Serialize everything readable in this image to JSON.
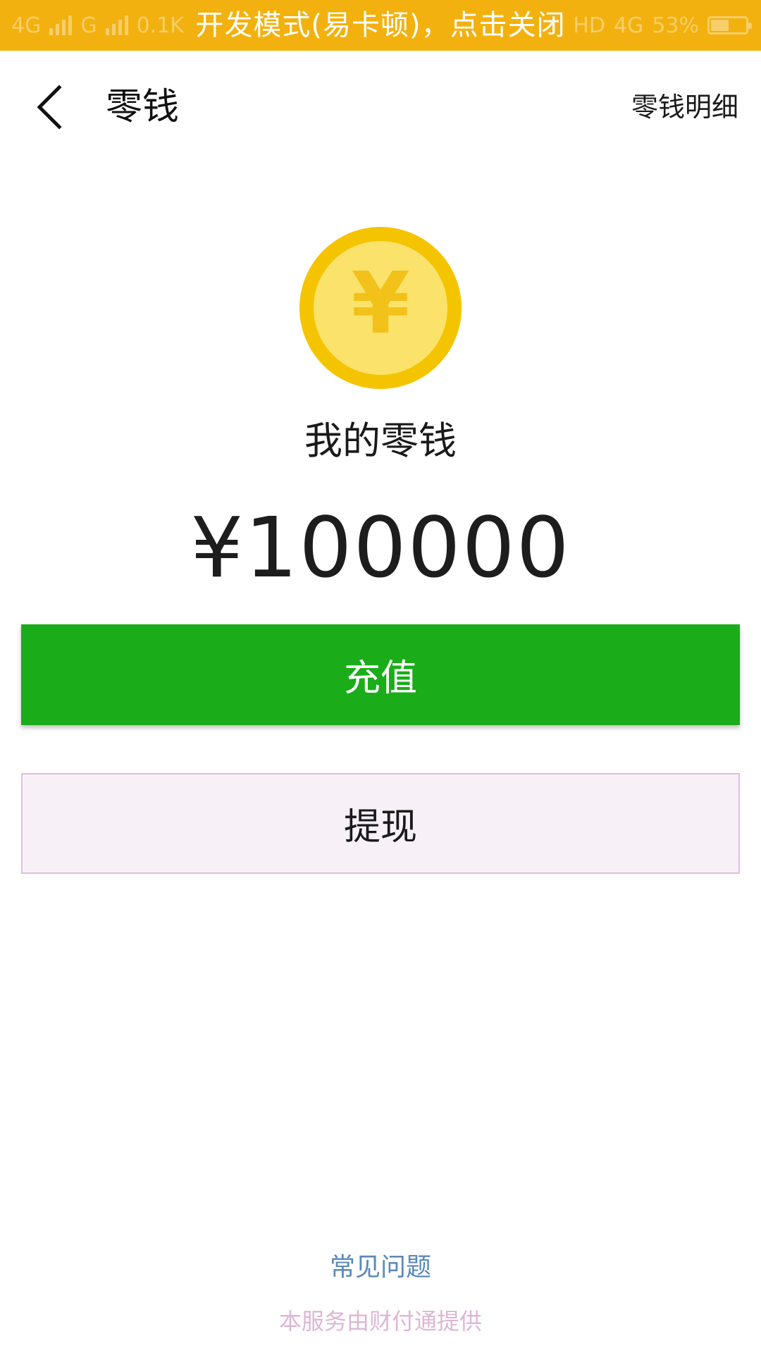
{
  "status_bar": {
    "network_left": "4G",
    "carrier_g": "G",
    "speed": "0.1K",
    "hd_label": "HD",
    "network_right": "4G",
    "battery_percent": "53%",
    "battery_level": 0.53
  },
  "dev_banner": {
    "text": "开发模式(易卡顿)，点击关闭"
  },
  "header": {
    "title": "零钱",
    "detail_link": "零钱明细"
  },
  "coin": {
    "symbol": "¥",
    "outer_color": "#f5c400",
    "inner_color": "#fbe26a",
    "symbol_color": "#f2c11a"
  },
  "wallet": {
    "section_title": "我的零钱",
    "balance": "¥100000"
  },
  "actions": {
    "recharge_label": "充值",
    "withdraw_label": "提现",
    "recharge_color": "#1aad19"
  },
  "footer": {
    "faq_link": "常见问题",
    "provider_text": "本服务由财付通提供"
  }
}
